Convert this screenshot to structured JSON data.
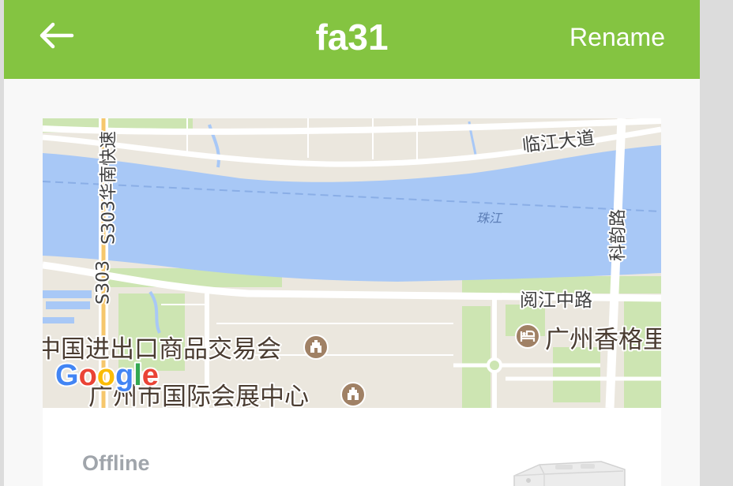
{
  "header": {
    "back_icon": "arrow-left-icon",
    "title": "fa31",
    "rename_label": "Rename"
  },
  "map": {
    "labels": {
      "road_top": "临江大道",
      "expressway": "S303华南快速",
      "expressway_short": "S303",
      "river": "珠江",
      "road_right": "科韵路",
      "road_south": "阅江中路",
      "poi_fair": "中国进出口商品交易会",
      "poi_hotel": "广州香格里",
      "poi_expo": "广州市国际会展中心"
    },
    "poi_icons": [
      "landmark-icon",
      "hotel-icon",
      "landmark-icon"
    ],
    "logo_text": "Google",
    "logo_colors": [
      "#4285F4",
      "#EA4335",
      "#FBBC05",
      "#4285F4",
      "#34A853",
      "#EA4335"
    ]
  },
  "device": {
    "status": "Offline",
    "image": "device-image"
  },
  "colors": {
    "header": "#84c441",
    "status_text": "#a0a5ab",
    "water": "#a8c8f6",
    "land": "#ebe7de",
    "park": "#cde5b2",
    "poi_icon": "#a08165"
  }
}
